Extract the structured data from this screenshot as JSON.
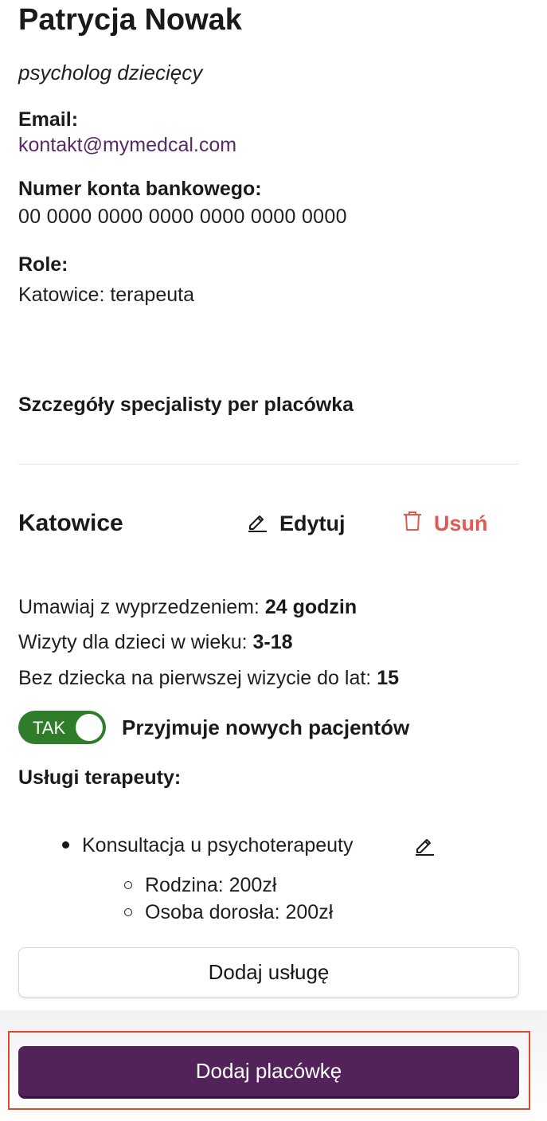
{
  "profile": {
    "name": "Patrycja Nowak",
    "profession": "psycholog dziecięcy",
    "email_label": "Email:",
    "email": "kontakt@mymedcal.com",
    "bank_label": "Numer konta bankowego:",
    "bank_account": "00 0000 0000 0000 0000 0000 0000",
    "roles_label": "Role:",
    "roles": "Katowice: terapeuta"
  },
  "section": {
    "title": "Szczegóły specjalisty per placówka"
  },
  "clinic": {
    "name": "Katowice",
    "edit_label": "Edytuj",
    "delete_label": "Usuń",
    "advance_label": "Umawiaj z wyprzedzeniem:",
    "advance_value": "24 godzin",
    "age_label": "Wizyty dla dzieci w wieku:",
    "age_value": "3-18",
    "no_child_label": "Bez dziecka na pierwszej wizycie do lat:",
    "no_child_value": "15",
    "toggle_text": "TAK",
    "toggle_label": "Przyjmuje nowych pacjentów",
    "services_title": "Usługi terapeuty:",
    "services": [
      {
        "name": "Konsultacja u psychoterapeuty",
        "prices": [
          "Rodzina: 200zł",
          "Osoba dorosła: 200zł"
        ]
      }
    ],
    "add_service_label": "Dodaj usługę"
  },
  "footer": {
    "add_clinic_label": "Dodaj placówkę"
  },
  "colors": {
    "primary": "#53225a",
    "toggle_on": "#2f7d2a",
    "danger": "#e05a55",
    "link": "#5a2a66",
    "highlight": "#e04a2a"
  },
  "icons": [
    "pencil-icon",
    "trash-icon"
  ]
}
